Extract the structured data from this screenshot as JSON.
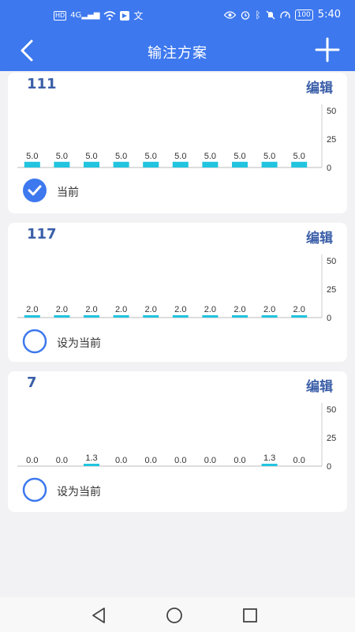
{
  "status_bar": {
    "left_icons": [
      "hd-icon",
      "signal-4g-icon",
      "wifi-icon",
      "app-notification-icon",
      "translate-icon"
    ],
    "hd_label": "HD",
    "network_label": "4G",
    "right_icons": [
      "eye-icon",
      "alarm-icon",
      "bluetooth-icon",
      "mute-icon",
      "speed-icon"
    ],
    "battery": "100",
    "time": "5:40"
  },
  "app_bar": {
    "title": "输注方案",
    "back_icon": "back-arrow-icon",
    "add_icon": "plus-icon"
  },
  "accent_color": "#3d78ee",
  "bar_color": "#22c4df",
  "plans": [
    {
      "name": "111",
      "edit_label": "编辑",
      "select_label": "当前",
      "selected": true,
      "chart_data": {
        "type": "bar",
        "values": [
          5.0,
          5.0,
          5.0,
          5.0,
          5.0,
          5.0,
          5.0,
          5.0,
          5.0,
          5.0
        ],
        "value_labels": [
          "5.0",
          "5.0",
          "5.0",
          "5.0",
          "5.0",
          "5.0",
          "5.0",
          "5.0",
          "5.0",
          "5.0"
        ],
        "ylim": [
          0,
          50
        ],
        "yticks": [
          "50",
          "25",
          "0"
        ],
        "axis": "right"
      }
    },
    {
      "name": "117",
      "edit_label": "编辑",
      "select_label": "设为当前",
      "selected": false,
      "chart_data": {
        "type": "bar",
        "values": [
          2.0,
          2.0,
          2.0,
          2.0,
          2.0,
          2.0,
          2.0,
          2.0,
          2.0,
          2.0
        ],
        "value_labels": [
          "2.0",
          "2.0",
          "2.0",
          "2.0",
          "2.0",
          "2.0",
          "2.0",
          "2.0",
          "2.0",
          "2.0"
        ],
        "ylim": [
          0,
          50
        ],
        "yticks": [
          "50",
          "25",
          "0"
        ],
        "axis": "right"
      }
    },
    {
      "name": "7",
      "edit_label": "编辑",
      "select_label": "设为当前",
      "selected": false,
      "chart_data": {
        "type": "bar",
        "values": [
          0.0,
          0.0,
          1.3,
          0.0,
          0.0,
          0.0,
          0.0,
          0.0,
          1.3,
          0.0
        ],
        "value_labels": [
          "0.0",
          "0.0",
          "1.3",
          "0.0",
          "0.0",
          "0.0",
          "0.0",
          "0.0",
          "1.3",
          "0.0"
        ],
        "ylim": [
          0,
          50
        ],
        "yticks": [
          "50",
          "25",
          "0"
        ],
        "axis": "right"
      }
    }
  ],
  "nav_bar": {
    "icons": [
      "nav-back-icon",
      "nav-home-icon",
      "nav-recent-icon"
    ]
  }
}
